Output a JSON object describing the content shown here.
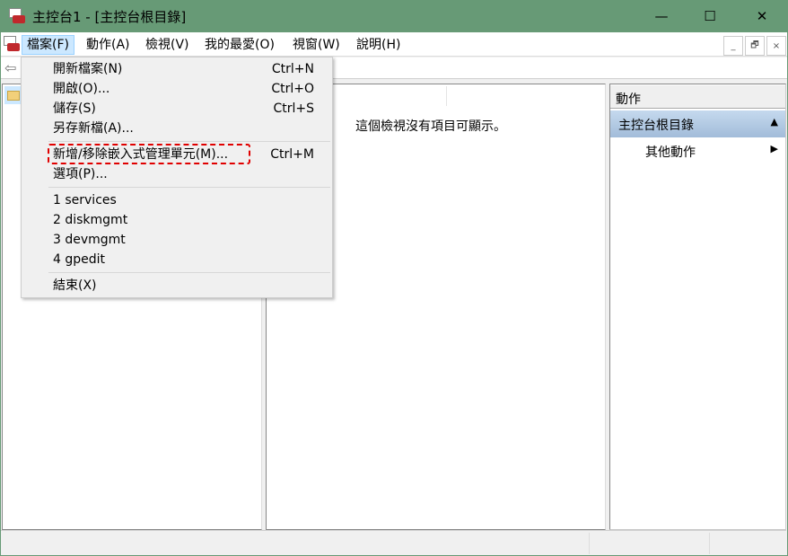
{
  "window": {
    "title": "主控台1 - [主控台根目錄]",
    "minimize": "—",
    "maximize": "☐",
    "close": "✕"
  },
  "menubar": {
    "items": [
      {
        "label": "檔案(F)"
      },
      {
        "label": "動作(A)"
      },
      {
        "label": "檢視(V)"
      },
      {
        "label": "我的最愛(O)"
      },
      {
        "label": "視窗(W)"
      },
      {
        "label": "說明(H)"
      }
    ],
    "mdi": {
      "minimize": "_",
      "restore": "🗗",
      "close": "×"
    }
  },
  "file_menu": {
    "items": [
      {
        "label": "開新檔案(N)",
        "shortcut": "Ctrl+N"
      },
      {
        "label": "開啟(O)...",
        "shortcut": "Ctrl+O"
      },
      {
        "label": "儲存(S)",
        "shortcut": "Ctrl+S"
      },
      {
        "label": "另存新檔(A)...",
        "shortcut": ""
      },
      {
        "label": "新增/移除嵌入式管理單元(M)...",
        "shortcut": "Ctrl+M"
      },
      {
        "label": "選項(P)...",
        "shortcut": ""
      },
      {
        "label": "1 services",
        "shortcut": ""
      },
      {
        "label": "2 diskmgmt",
        "shortcut": ""
      },
      {
        "label": "3 devmgmt",
        "shortcut": ""
      },
      {
        "label": "4 gpedit",
        "shortcut": ""
      },
      {
        "label": "結束(X)",
        "shortcut": ""
      }
    ]
  },
  "center": {
    "empty_message": "這個檢視沒有項目可顯示。"
  },
  "actions": {
    "header": "動作",
    "section": "主控台根目錄",
    "items": [
      {
        "label": "其他動作"
      }
    ]
  },
  "colors": {
    "titlebar": "#679a76",
    "highlight": "#cce8ff",
    "annotation": "#e00000"
  }
}
